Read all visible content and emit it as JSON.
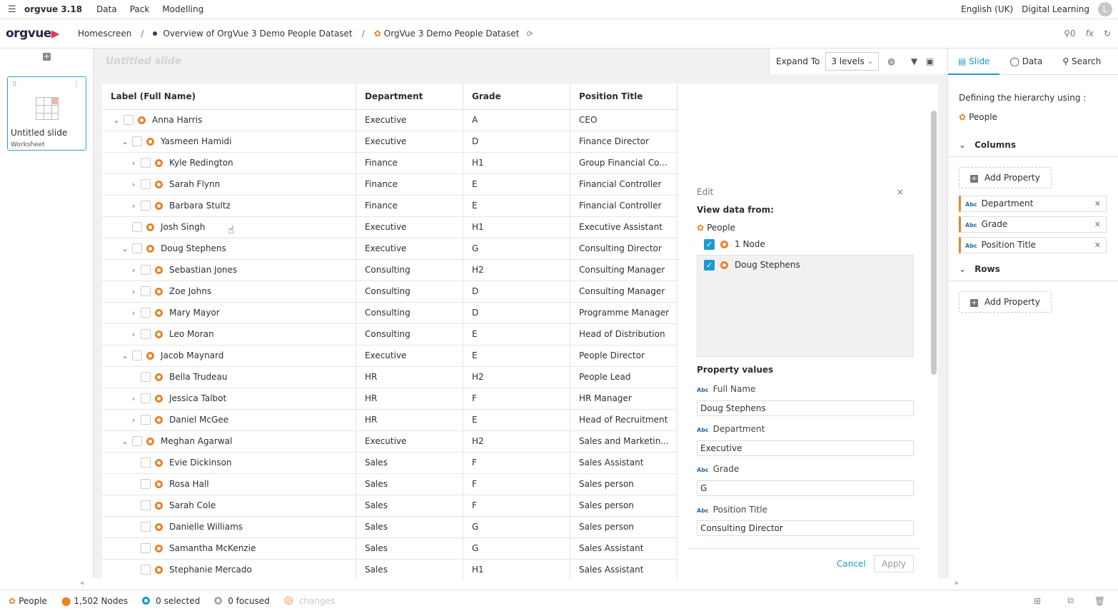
{
  "menubar": {
    "app": "orgvue 3.18",
    "menus": [
      "Data",
      "Pack",
      "Modelling"
    ],
    "language": "English (UK)",
    "learning": "Digital Learning",
    "avatar": "L"
  },
  "breadcrumb": {
    "logo": "orgvue",
    "home": "Homescreen",
    "overview": "Overview of OrgVue 3 Demo People Dataset",
    "dataset": "OrgVue 3 Demo People Dataset",
    "count": "0",
    "fx": "fx"
  },
  "slides": {
    "title": "Untitled slide",
    "type": "Worksheet"
  },
  "slide_title": "Untitled slide",
  "toolbar": {
    "expand_label": "Expand To",
    "levels": "3 levels"
  },
  "table": {
    "headers": [
      "Label (Full Name)",
      "Department",
      "Grade",
      "Position Title"
    ],
    "rows": [
      {
        "level": 0,
        "expand": "open",
        "name": "Anna Harris",
        "dept": "Executive",
        "grade": "A",
        "title": "CEO"
      },
      {
        "level": 1,
        "expand": "open",
        "name": "Yasmeen Hamidi",
        "dept": "Executive",
        "grade": "D",
        "title": "Finance Director"
      },
      {
        "level": 2,
        "expand": "closed",
        "name": "Kyle Redington",
        "dept": "Finance",
        "grade": "H1",
        "title": "Group Financial Co..."
      },
      {
        "level": 2,
        "expand": "closed",
        "name": "Sarah Flynn",
        "dept": "Finance",
        "grade": "E",
        "title": "Financial Controller"
      },
      {
        "level": 2,
        "expand": "closed",
        "name": "Barbara Stultz",
        "dept": "Finance",
        "grade": "E",
        "title": "Financial Controller"
      },
      {
        "level": 1,
        "expand": "none",
        "name": "Josh Singh",
        "dept": "Executive",
        "grade": "H1",
        "title": "Executive Assistant"
      },
      {
        "level": 1,
        "expand": "open",
        "name": "Doug Stephens",
        "dept": "Executive",
        "grade": "G",
        "title": "Consulting Director"
      },
      {
        "level": 2,
        "expand": "closed",
        "name": "Sebastian Jones",
        "dept": "Consulting",
        "grade": "H2",
        "title": "Consulting Manager"
      },
      {
        "level": 2,
        "expand": "closed",
        "name": "Zoe Johns",
        "dept": "Consulting",
        "grade": "D",
        "title": "Consulting Manager"
      },
      {
        "level": 2,
        "expand": "closed",
        "name": "Mary Mayor",
        "dept": "Consulting",
        "grade": "D",
        "title": "Programme Manager"
      },
      {
        "level": 2,
        "expand": "closed",
        "name": "Leo Moran",
        "dept": "Consulting",
        "grade": "E",
        "title": "Head of Distribution"
      },
      {
        "level": 1,
        "expand": "open",
        "name": "Jacob Maynard",
        "dept": "Executive",
        "grade": "E",
        "title": "People Director"
      },
      {
        "level": 2,
        "expand": "none",
        "name": "Bella Trudeau",
        "dept": "HR",
        "grade": "H2",
        "title": "People Lead"
      },
      {
        "level": 2,
        "expand": "closed",
        "name": "Jessica Talbot",
        "dept": "HR",
        "grade": "F",
        "title": "HR Manager"
      },
      {
        "level": 2,
        "expand": "closed",
        "name": "Daniel McGee",
        "dept": "HR",
        "grade": "E",
        "title": "Head of Recruitment"
      },
      {
        "level": 1,
        "expand": "open",
        "name": "Meghan Agarwal",
        "dept": "Executive",
        "grade": "H2",
        "title": "Sales and Marketin..."
      },
      {
        "level": 2,
        "expand": "none",
        "name": "Evie Dickinson",
        "dept": "Sales",
        "grade": "F",
        "title": "Sales Assistant"
      },
      {
        "level": 2,
        "expand": "none",
        "name": "Rosa Hall",
        "dept": "Sales",
        "grade": "F",
        "title": "Sales person"
      },
      {
        "level": 2,
        "expand": "none",
        "name": "Sarah Cole",
        "dept": "Sales",
        "grade": "F",
        "title": "Sales person"
      },
      {
        "level": 2,
        "expand": "none",
        "name": "Danielle Williams",
        "dept": "Sales",
        "grade": "G",
        "title": "Sales person"
      },
      {
        "level": 2,
        "expand": "none",
        "name": "Samantha McKenzie",
        "dept": "Sales",
        "grade": "G",
        "title": "Sales Assistant"
      },
      {
        "level": 2,
        "expand": "none",
        "name": "Stephanie Mercado",
        "dept": "Sales",
        "grade": "H1",
        "title": "Sales Assistant"
      }
    ]
  },
  "edit": {
    "header": "Edit",
    "close": "×",
    "view_from": "View data from:",
    "dataset": "People",
    "nodes": "1 Node",
    "selected": "Doug Stephens",
    "property_values": "Property values",
    "fields": [
      {
        "label": "Full Name",
        "value": "Doug Stephens"
      },
      {
        "label": "Department",
        "value": "Executive"
      },
      {
        "label": "Grade",
        "value": "G"
      },
      {
        "label": "Position Title",
        "value": "Consulting Director"
      }
    ],
    "cancel": "Cancel",
    "apply": "Apply",
    "abc": "Abc"
  },
  "sidebar": {
    "tabs": [
      "Slide",
      "Data",
      "Search"
    ],
    "defining": "Defining the hierarchy using :",
    "dataset": "People",
    "columns_label": "Columns",
    "rows_label": "Rows",
    "add_property": "Add Property",
    "columns": [
      "Department",
      "Grade",
      "Position Title"
    ],
    "abc": "Abc"
  },
  "status": {
    "dataset": "People",
    "nodes": "1,502 Nodes",
    "selected": "0 selected",
    "focused": "0 focused",
    "changes": "changes",
    "changes_count": "0"
  },
  "colors": {
    "accent": "#1a9bd1",
    "node": "#e8832a",
    "brand": "#e5365a"
  }
}
